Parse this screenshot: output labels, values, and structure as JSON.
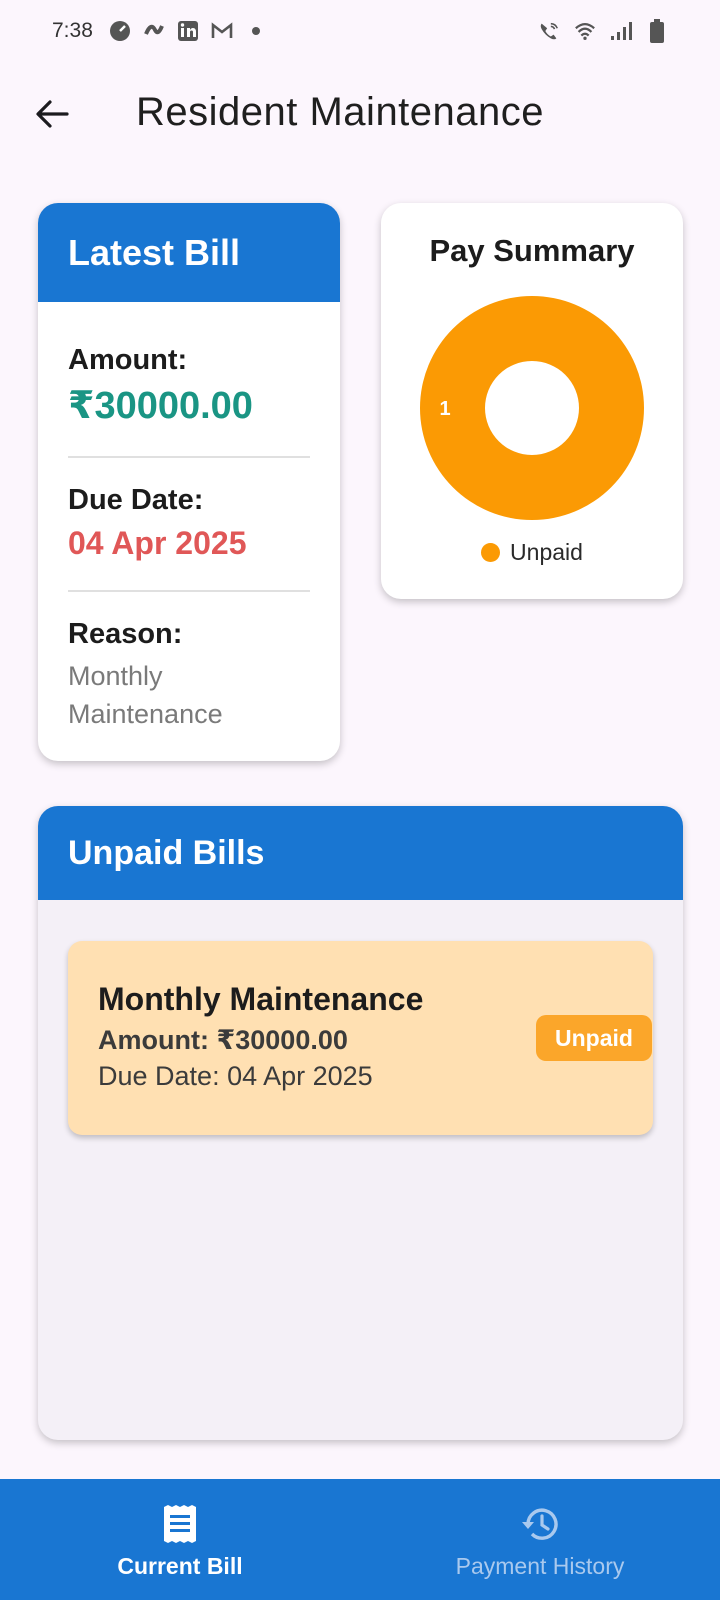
{
  "status_bar": {
    "time": "7:38",
    "left_icons": [
      "speedometer-icon",
      "app-icon",
      "linkedin-icon",
      "gmail-icon",
      "dot-icon"
    ],
    "right_icons": [
      "wifi-call-icon",
      "wifi-icon",
      "signal-icon",
      "battery-icon"
    ]
  },
  "app_bar": {
    "title": "Resident Maintenance",
    "back_icon": "arrow-left-icon"
  },
  "latest_bill": {
    "header": "Latest Bill",
    "amount_label": "Amount:",
    "amount_value": "₹30000.00",
    "due_label": "Due Date:",
    "due_value": "04 Apr 2025",
    "reason_label": "Reason:",
    "reason_value_line1": "Monthly",
    "reason_value_line2": "Maintenance"
  },
  "pay_summary": {
    "title": "Pay Summary",
    "chart_data": {
      "type": "pie",
      "categories": [
        "Unpaid"
      ],
      "values": [
        1
      ],
      "data_labels": [
        "1"
      ],
      "colors": [
        "#fb9a04"
      ],
      "legend": "bottom"
    },
    "legend_label": "Unpaid"
  },
  "unpaid_bills": {
    "header": "Unpaid Bills",
    "items": [
      {
        "title": "Monthly Maintenance",
        "amount": "Amount: ₹30000.00",
        "due": "Due Date: 04 Apr 2025",
        "status": "Unpaid"
      }
    ]
  },
  "bottom_nav": {
    "items": [
      {
        "label": "Current Bill",
        "icon": "receipt-icon",
        "active": true
      },
      {
        "label": "Payment History",
        "icon": "history-icon",
        "active": false
      }
    ]
  },
  "colors": {
    "primary": "#1976d2",
    "amount": "#1a9584",
    "due": "#e05757",
    "unpaid": "#fb9a04",
    "bill_item_bg": "#ffe0b2"
  }
}
